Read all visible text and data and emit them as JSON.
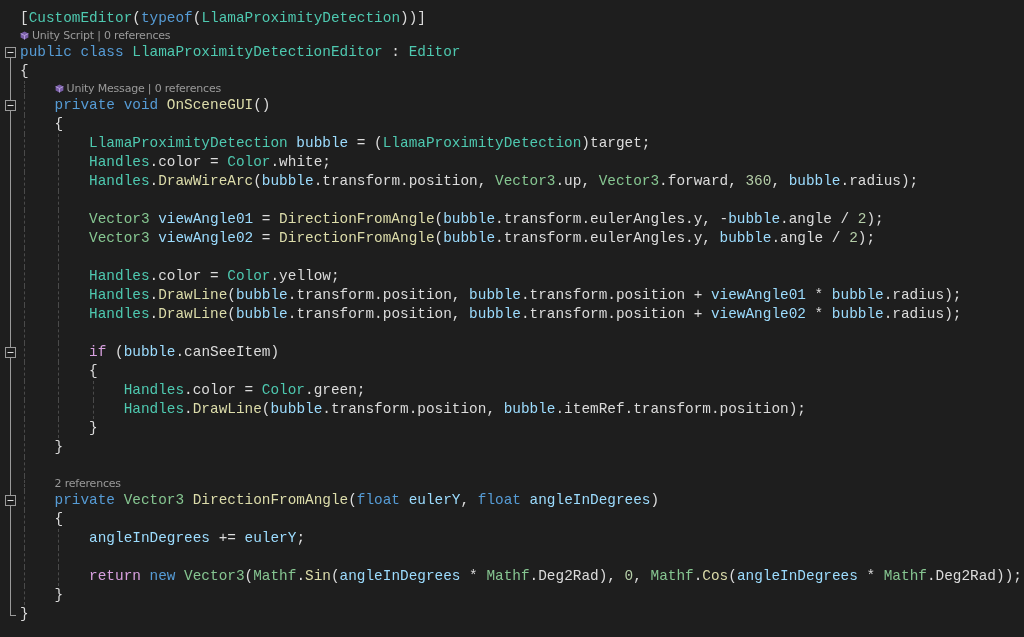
{
  "editor": {
    "lines": [
      {
        "kind": "code",
        "tokens": [
          {
            "text": "[",
            "kind": "txt"
          },
          {
            "text": "CustomEditor",
            "kind": "cls"
          },
          {
            "text": "(",
            "kind": "txt"
          },
          {
            "text": "typeof",
            "kind": "kw"
          },
          {
            "text": "(",
            "kind": "txt"
          },
          {
            "text": "LlamaProximityDetection",
            "kind": "cls"
          },
          {
            "text": "))]",
            "kind": "txt"
          }
        ]
      },
      {
        "kind": "lens",
        "icon": true,
        "text": "Unity Script | 0 references"
      },
      {
        "kind": "code",
        "expanded": true,
        "tokens": [
          {
            "text": "public class ",
            "kind": "kw"
          },
          {
            "text": "LlamaProximityDetectionEditor",
            "kind": "cls"
          },
          {
            "text": " : ",
            "kind": "txt"
          },
          {
            "text": "Editor",
            "kind": "cls"
          }
        ]
      },
      {
        "kind": "code",
        "tokens": [
          {
            "text": "{",
            "kind": "txt"
          }
        ]
      },
      {
        "kind": "lens",
        "icon": true,
        "text": "Unity Message | 0 references"
      },
      {
        "kind": "code",
        "expanded": true,
        "tokens": [
          {
            "text": "    private void ",
            "kind": "kw"
          },
          {
            "text": "OnSceneGUI",
            "kind": "fn"
          },
          {
            "text": "()",
            "kind": "txt"
          }
        ]
      },
      {
        "kind": "code",
        "tokens": [
          {
            "text": "    {",
            "kind": "txt"
          }
        ]
      },
      {
        "kind": "code",
        "tokens": [
          {
            "text": "        LlamaProximityDetection ",
            "kind": "cls"
          },
          {
            "text": "bubble",
            "kind": "var"
          },
          {
            "text": " = (",
            "kind": "txt"
          },
          {
            "text": "LlamaProximityDetection",
            "kind": "cls"
          },
          {
            "text": ")target;",
            "kind": "txt"
          }
        ]
      },
      {
        "kind": "code",
        "tokens": [
          {
            "text": "        Handles",
            "kind": "cls"
          },
          {
            "text": ".color = ",
            "kind": "txt"
          },
          {
            "text": "Color",
            "kind": "cls"
          },
          {
            "text": ".white;",
            "kind": "txt"
          }
        ]
      },
      {
        "kind": "code",
        "tokens": [
          {
            "text": "        Handles",
            "kind": "cls"
          },
          {
            "text": ".",
            "kind": "txt"
          },
          {
            "text": "DrawWireArc",
            "kind": "fn"
          },
          {
            "text": "(",
            "kind": "txt"
          },
          {
            "text": "bubble",
            "kind": "var"
          },
          {
            "text": ".transform.position, ",
            "kind": "txt"
          },
          {
            "text": "Vector3",
            "kind": "struct"
          },
          {
            "text": ".up, ",
            "kind": "txt"
          },
          {
            "text": "Vector3",
            "kind": "struct"
          },
          {
            "text": ".forward, ",
            "kind": "txt"
          },
          {
            "text": "360",
            "kind": "num"
          },
          {
            "text": ", ",
            "kind": "txt"
          },
          {
            "text": "bubble",
            "kind": "var"
          },
          {
            "text": ".radius);",
            "kind": "txt"
          }
        ]
      },
      {
        "kind": "blank"
      },
      {
        "kind": "code",
        "tokens": [
          {
            "text": "        Vector3 ",
            "kind": "struct"
          },
          {
            "text": "viewAngle01",
            "kind": "var"
          },
          {
            "text": " = ",
            "kind": "txt"
          },
          {
            "text": "DirectionFromAngle",
            "kind": "fn"
          },
          {
            "text": "(",
            "kind": "txt"
          },
          {
            "text": "bubble",
            "kind": "var"
          },
          {
            "text": ".transform.eulerAngles.y, -",
            "kind": "txt"
          },
          {
            "text": "bubble",
            "kind": "var"
          },
          {
            "text": ".angle / ",
            "kind": "txt"
          },
          {
            "text": "2",
            "kind": "num"
          },
          {
            "text": ");",
            "kind": "txt"
          }
        ]
      },
      {
        "kind": "code",
        "tokens": [
          {
            "text": "        Vector3 ",
            "kind": "struct"
          },
          {
            "text": "viewAngle02",
            "kind": "var"
          },
          {
            "text": " = ",
            "kind": "txt"
          },
          {
            "text": "DirectionFromAngle",
            "kind": "fn"
          },
          {
            "text": "(",
            "kind": "txt"
          },
          {
            "text": "bubble",
            "kind": "var"
          },
          {
            "text": ".transform.eulerAngles.y, ",
            "kind": "txt"
          },
          {
            "text": "bubble",
            "kind": "var"
          },
          {
            "text": ".angle / ",
            "kind": "txt"
          },
          {
            "text": "2",
            "kind": "num"
          },
          {
            "text": ");",
            "kind": "txt"
          }
        ]
      },
      {
        "kind": "blank"
      },
      {
        "kind": "code",
        "tokens": [
          {
            "text": "        Handles",
            "kind": "cls"
          },
          {
            "text": ".color = ",
            "kind": "txt"
          },
          {
            "text": "Color",
            "kind": "cls"
          },
          {
            "text": ".yellow;",
            "kind": "txt"
          }
        ]
      },
      {
        "kind": "code",
        "tokens": [
          {
            "text": "        Handles",
            "kind": "cls"
          },
          {
            "text": ".",
            "kind": "txt"
          },
          {
            "text": "DrawLine",
            "kind": "fn"
          },
          {
            "text": "(",
            "kind": "txt"
          },
          {
            "text": "bubble",
            "kind": "var"
          },
          {
            "text": ".transform.position, ",
            "kind": "txt"
          },
          {
            "text": "bubble",
            "kind": "var"
          },
          {
            "text": ".transform.position + ",
            "kind": "txt"
          },
          {
            "text": "viewAngle01",
            "kind": "var"
          },
          {
            "text": " * ",
            "kind": "txt"
          },
          {
            "text": "bubble",
            "kind": "var"
          },
          {
            "text": ".radius);",
            "kind": "txt"
          }
        ]
      },
      {
        "kind": "code",
        "tokens": [
          {
            "text": "        Handles",
            "kind": "cls"
          },
          {
            "text": ".",
            "kind": "txt"
          },
          {
            "text": "DrawLine",
            "kind": "fn"
          },
          {
            "text": "(",
            "kind": "txt"
          },
          {
            "text": "bubble",
            "kind": "var"
          },
          {
            "text": ".transform.position, ",
            "kind": "txt"
          },
          {
            "text": "bubble",
            "kind": "var"
          },
          {
            "text": ".transform.position + ",
            "kind": "txt"
          },
          {
            "text": "viewAngle02",
            "kind": "var"
          },
          {
            "text": " * ",
            "kind": "txt"
          },
          {
            "text": "bubble",
            "kind": "var"
          },
          {
            "text": ".radius);",
            "kind": "txt"
          }
        ]
      },
      {
        "kind": "blank"
      },
      {
        "kind": "code",
        "expanded": true,
        "tokens": [
          {
            "text": "        if",
            "kind": "ctl"
          },
          {
            "text": " (",
            "kind": "txt"
          },
          {
            "text": "bubble",
            "kind": "var"
          },
          {
            "text": ".canSeeItem)",
            "kind": "txt"
          }
        ]
      },
      {
        "kind": "code",
        "tokens": [
          {
            "text": "        {",
            "kind": "txt"
          }
        ]
      },
      {
        "kind": "code",
        "tokens": [
          {
            "text": "            Handles",
            "kind": "cls"
          },
          {
            "text": ".color = ",
            "kind": "txt"
          },
          {
            "text": "Color",
            "kind": "cls"
          },
          {
            "text": ".green;",
            "kind": "txt"
          }
        ]
      },
      {
        "kind": "code",
        "tokens": [
          {
            "text": "            Handles",
            "kind": "cls"
          },
          {
            "text": ".",
            "kind": "txt"
          },
          {
            "text": "DrawLine",
            "kind": "fn"
          },
          {
            "text": "(",
            "kind": "txt"
          },
          {
            "text": "bubble",
            "kind": "var"
          },
          {
            "text": ".transform.position, ",
            "kind": "txt"
          },
          {
            "text": "bubble",
            "kind": "var"
          },
          {
            "text": ".itemRef.transform.position);",
            "kind": "txt"
          }
        ]
      },
      {
        "kind": "code",
        "tokens": [
          {
            "text": "        }",
            "kind": "txt"
          }
        ]
      },
      {
        "kind": "code",
        "tokens": [
          {
            "text": "    }",
            "kind": "txt"
          }
        ]
      },
      {
        "kind": "blank"
      },
      {
        "kind": "lens",
        "icon": false,
        "text": "2 references"
      },
      {
        "kind": "code",
        "expanded": true,
        "tokens": [
          {
            "text": "    private ",
            "kind": "kw"
          },
          {
            "text": "Vector3 ",
            "kind": "struct"
          },
          {
            "text": "DirectionFromAngle",
            "kind": "fn"
          },
          {
            "text": "(",
            "kind": "txt"
          },
          {
            "text": "float ",
            "kind": "kw"
          },
          {
            "text": "eulerY",
            "kind": "var"
          },
          {
            "text": ", ",
            "kind": "txt"
          },
          {
            "text": "float ",
            "kind": "kw"
          },
          {
            "text": "angleInDegrees",
            "kind": "var"
          },
          {
            "text": ")",
            "kind": "txt"
          }
        ]
      },
      {
        "kind": "code",
        "tokens": [
          {
            "text": "    {",
            "kind": "txt"
          }
        ]
      },
      {
        "kind": "code",
        "tokens": [
          {
            "text": "        angleInDegrees",
            "kind": "var"
          },
          {
            "text": " += ",
            "kind": "txt"
          },
          {
            "text": "eulerY",
            "kind": "var"
          },
          {
            "text": ";",
            "kind": "txt"
          }
        ]
      },
      {
        "kind": "blank"
      },
      {
        "kind": "code",
        "tokens": [
          {
            "text": "        return ",
            "kind": "ctl"
          },
          {
            "text": "new ",
            "kind": "kw"
          },
          {
            "text": "Vector3",
            "kind": "struct"
          },
          {
            "text": "(",
            "kind": "txt"
          },
          {
            "text": "Mathf",
            "kind": "struct"
          },
          {
            "text": ".",
            "kind": "txt"
          },
          {
            "text": "Sin",
            "kind": "fn"
          },
          {
            "text": "(",
            "kind": "txt"
          },
          {
            "text": "angleInDegrees",
            "kind": "var"
          },
          {
            "text": " * ",
            "kind": "txt"
          },
          {
            "text": "Mathf",
            "kind": "struct"
          },
          {
            "text": ".Deg2Rad), ",
            "kind": "txt"
          },
          {
            "text": "0",
            "kind": "num"
          },
          {
            "text": ", ",
            "kind": "txt"
          },
          {
            "text": "Mathf",
            "kind": "struct"
          },
          {
            "text": ".",
            "kind": "txt"
          },
          {
            "text": "Cos",
            "kind": "fn"
          },
          {
            "text": "(",
            "kind": "txt"
          },
          {
            "text": "angleInDegrees",
            "kind": "var"
          },
          {
            "text": " * ",
            "kind": "txt"
          },
          {
            "text": "Mathf",
            "kind": "struct"
          },
          {
            "text": ".Deg2Rad));",
            "kind": "txt"
          }
        ]
      },
      {
        "kind": "code",
        "tokens": [
          {
            "text": "    }",
            "kind": "txt"
          }
        ]
      },
      {
        "kind": "code",
        "tokens": [
          {
            "text": "}",
            "kind": "txt"
          }
        ]
      }
    ]
  }
}
